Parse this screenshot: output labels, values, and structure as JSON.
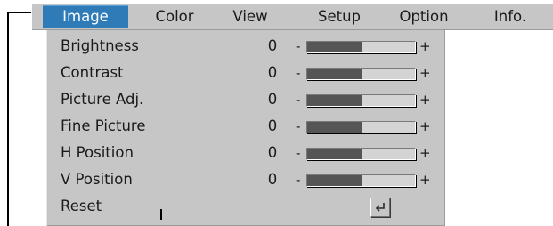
{
  "menubar": {
    "tabs": [
      {
        "label": "Image",
        "active": true
      },
      {
        "label": "Color",
        "active": false
      },
      {
        "label": "View",
        "active": false
      },
      {
        "label": "Setup",
        "active": false
      },
      {
        "label": "Option",
        "active": false
      },
      {
        "label": "Info.",
        "active": false
      }
    ]
  },
  "image_menu": {
    "items": [
      {
        "label": "Brightness",
        "value": "0",
        "minus": "-",
        "plus": "+",
        "level": 0.5
      },
      {
        "label": "Contrast",
        "value": "0",
        "minus": "-",
        "plus": "+",
        "level": 0.5
      },
      {
        "label": "Picture Adj.",
        "value": "0",
        "minus": "-",
        "plus": "+",
        "level": 0.5
      },
      {
        "label": "Fine Picture",
        "value": "0",
        "minus": "-",
        "plus": "+",
        "level": 0.5
      },
      {
        "label": "H Position",
        "value": "0",
        "minus": "-",
        "plus": "+",
        "level": 0.5
      },
      {
        "label": "V Position",
        "value": "0",
        "minus": "-",
        "plus": "+",
        "level": 0.5
      }
    ],
    "reset": {
      "label": "Reset",
      "icon": "enter-icon"
    }
  },
  "colors": {
    "menu_bg": "#c6c6c6",
    "active_tab": "#2e7bb8",
    "slider_fill": "#555555"
  }
}
